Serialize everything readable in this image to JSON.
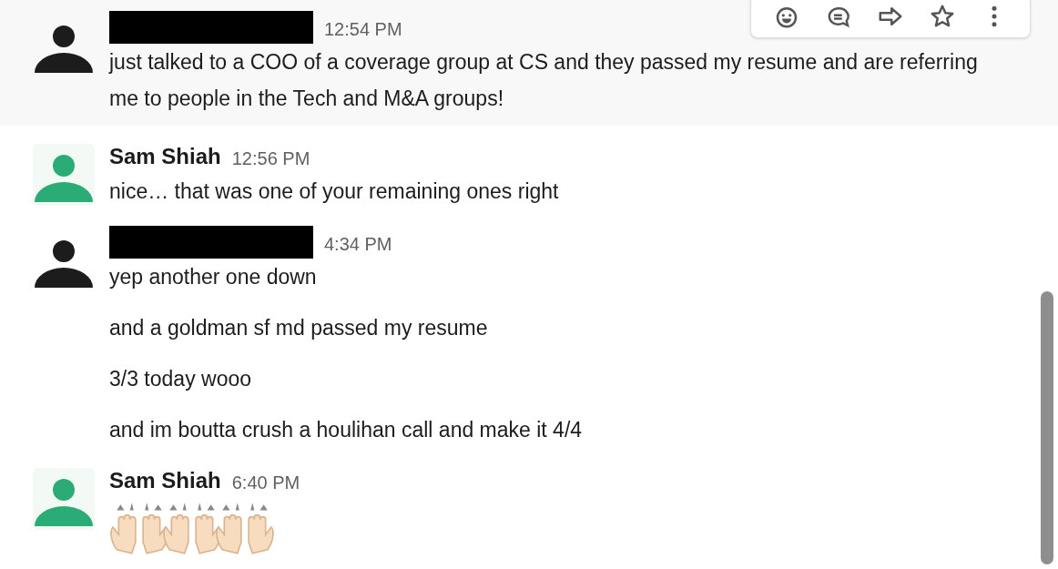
{
  "toolbar": {
    "actions": [
      {
        "kind": "emoji"
      },
      {
        "kind": "comment"
      },
      {
        "kind": "share"
      },
      {
        "kind": "star"
      },
      {
        "kind": "more"
      }
    ]
  },
  "messages": [
    {
      "avatar": {
        "color": "#1d1c1d"
      },
      "sender_redacted": true,
      "time": "12:54 PM",
      "highlighted": true,
      "lines": [
        "just talked to a COO of a coverage group at CS and they passed my resume and are referring me to people in the Tech and M&A groups!"
      ]
    },
    {
      "avatar": {
        "color": "#2bac76"
      },
      "sender": "Sam Shiah",
      "time": "12:56 PM",
      "highlighted": false,
      "lines": [
        "nice… that was one of your remaining ones right"
      ]
    },
    {
      "avatar": {
        "color": "#1d1c1d"
      },
      "sender_redacted": true,
      "time": "4:34 PM",
      "highlighted": false,
      "lines": [
        "yep another one down",
        "and a goldman sf md passed my resume",
        "3/3 today wooo",
        "and im boutta crush a houlihan call and make it 4/4"
      ]
    },
    {
      "avatar": {
        "color": "#2bac76"
      },
      "sender": "Sam Shiah",
      "time": "6:40 PM",
      "highlighted": false,
      "emojis": [
        {
          "kind": "raised-hands"
        },
        {
          "kind": "raised-hands"
        },
        {
          "kind": "raised-hands"
        }
      ]
    }
  ]
}
